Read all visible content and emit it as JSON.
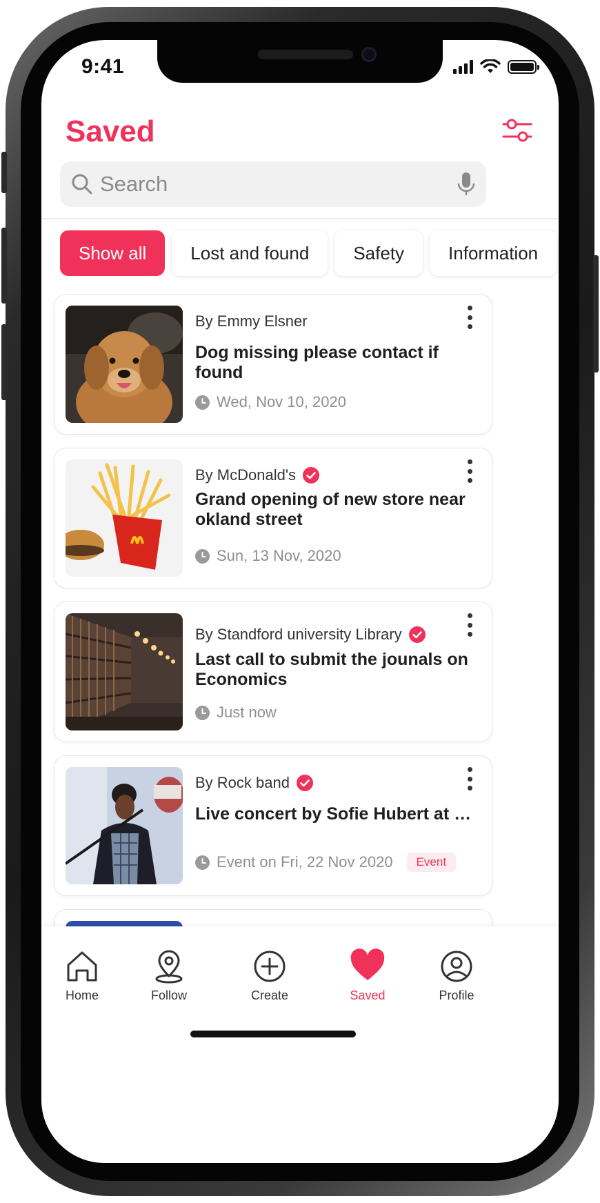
{
  "status": {
    "time": "9:41"
  },
  "header": {
    "title": "Saved"
  },
  "search": {
    "placeholder": "Search"
  },
  "chips": [
    {
      "label": "Show all",
      "active": true
    },
    {
      "label": "Lost and found",
      "active": false
    },
    {
      "label": "Safety",
      "active": false
    },
    {
      "label": "Information",
      "active": false
    }
  ],
  "posts": [
    {
      "author": "By Emmy Elsner",
      "verified": false,
      "title": "Dog missing please contact if found",
      "meta": "Wed, Nov 10, 2020",
      "badge": "",
      "image": "dog"
    },
    {
      "author": "By McDonald's",
      "verified": true,
      "title": "Grand opening of new store near okland street",
      "meta": "Sun, 13 Nov, 2020",
      "badge": "",
      "image": "fries"
    },
    {
      "author": "By Standford university Library",
      "verified": true,
      "title": "Last call to submit the jounals on Economics",
      "meta": "Just now",
      "badge": "",
      "image": "library"
    },
    {
      "author": "By Rock band",
      "verified": true,
      "title": "Live concert by Sofie Hubert at …",
      "meta": "Event on Fri, 22 Nov 2020",
      "badge": "Event",
      "image": "concert"
    }
  ],
  "nav": [
    {
      "label": "Home",
      "icon": "home-icon",
      "active": false
    },
    {
      "label": "Follow",
      "icon": "location-pin-icon",
      "active": false
    },
    {
      "label": "Create",
      "icon": "plus-circle-icon",
      "active": false
    },
    {
      "label": "Saved",
      "icon": "heart-icon",
      "active": true
    },
    {
      "label": "Profile",
      "icon": "user-circle-icon",
      "active": false
    }
  ],
  "colors": {
    "accent": "#f0325a",
    "text": "#1f1f1f",
    "muted": "#8e8e8e"
  }
}
